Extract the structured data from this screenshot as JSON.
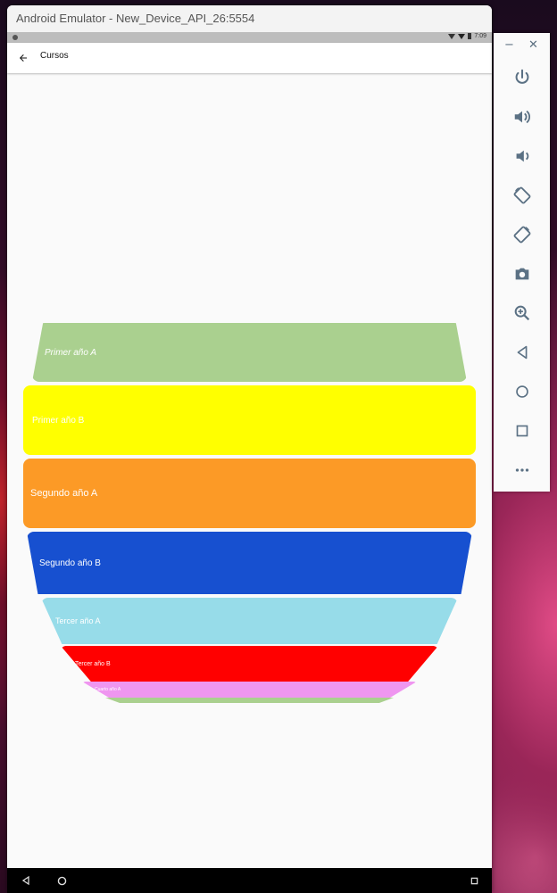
{
  "emulator": {
    "title": "Android Emulator - New_Device_API_26:5554",
    "minimize_label": "−",
    "close_label": "✕"
  },
  "status_bar": {
    "time": "7:09"
  },
  "app_bar": {
    "back_icon": "arrow-left-icon",
    "title": "Cursos"
  },
  "courses": [
    {
      "label": "Primer año A",
      "color": "#aad08f",
      "italic": true
    },
    {
      "label": "Primer año B",
      "color": "#ffff00",
      "italic": false
    },
    {
      "label": "Segundo año A",
      "color": "#fc9a26",
      "italic": false
    },
    {
      "label": "Segundo año B",
      "color": "#1750d0",
      "italic": false
    },
    {
      "label": "Tercer año A",
      "color": "#97dce9",
      "italic": false
    },
    {
      "label": "Tercer año B",
      "color": "#ff0000",
      "italic": false
    },
    {
      "label": "Cuarto año A",
      "color": "#ef96f0",
      "italic": false
    },
    {
      "label": "",
      "color": "#aad08f",
      "italic": false
    }
  ],
  "toolbar": {
    "buttons": [
      {
        "name": "power-icon"
      },
      {
        "name": "volume-up-icon"
      },
      {
        "name": "volume-down-icon"
      },
      {
        "name": "rotate-left-icon"
      },
      {
        "name": "rotate-right-icon"
      },
      {
        "name": "camera-icon"
      },
      {
        "name": "zoom-icon"
      },
      {
        "name": "back-icon"
      },
      {
        "name": "home-icon"
      },
      {
        "name": "overview-icon"
      },
      {
        "name": "more-icon"
      }
    ]
  },
  "nav_bar": {
    "buttons": [
      "back-nav-icon",
      "home-nav-icon",
      "recents-nav-icon"
    ]
  }
}
